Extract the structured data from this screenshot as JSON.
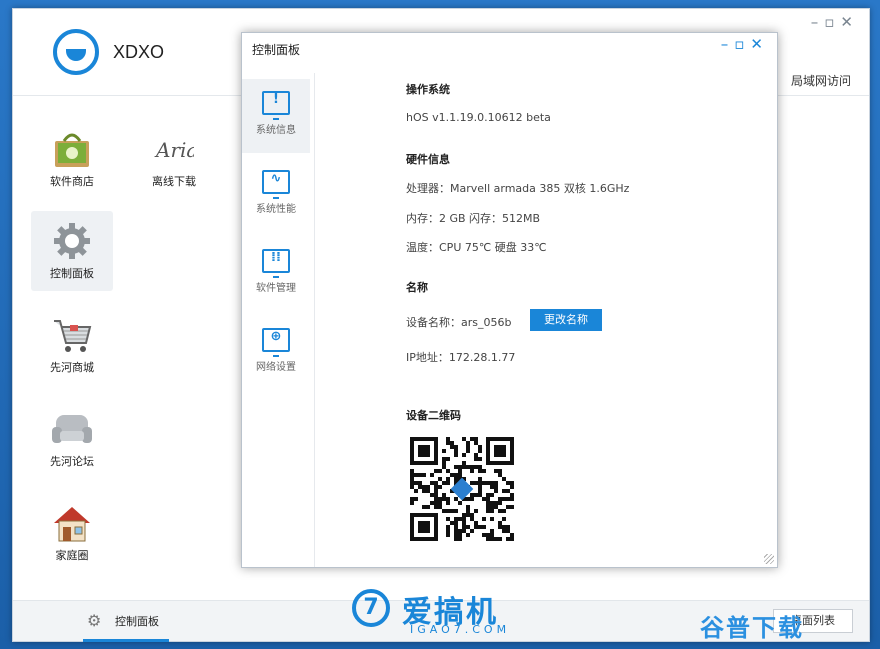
{
  "app": {
    "title": "XDXO",
    "lan_access": "局域网访问"
  },
  "left_apps": [
    {
      "label": "软件商店"
    },
    {
      "label": "离线下载"
    },
    {
      "label": "控制面板"
    },
    {
      "label": "先河商城"
    },
    {
      "label": "先河论坛"
    },
    {
      "label": "家庭圈"
    }
  ],
  "taskbar": {
    "item_label": "控制面板",
    "right_button": "桌面列表"
  },
  "dialog": {
    "title": "控制面板",
    "sidebar": [
      {
        "label": "系统信息",
        "icon": "exclamation-monitor-icon"
      },
      {
        "label": "系统性能",
        "icon": "pulse-monitor-icon"
      },
      {
        "label": "软件管理",
        "icon": "grid-monitor-icon"
      },
      {
        "label": "网络设置",
        "icon": "globe-monitor-icon"
      }
    ],
    "os": {
      "title": "操作系统",
      "version": "hOS v1.1.19.0.10612 beta"
    },
    "hardware": {
      "title": "硬件信息",
      "cpu": "处理器：Marvell armada 385 双核 1.6GHz",
      "memory": "内存：2 GB 闪存：512MB",
      "temp": "温度：CPU 75℃ 硬盘 33℃"
    },
    "name": {
      "title": "名称",
      "device_name": "设备名称：ars_056b",
      "rename_button": "更改名称",
      "ip": "IP地址：172.28.1.77"
    },
    "qr": {
      "title": "设备二维码"
    }
  },
  "watermark": {
    "text": "爱搞机",
    "sub": "IGAO7.COM",
    "glyph": "7",
    "corner": "谷普下载"
  },
  "colors": {
    "accent": "#1a86d8",
    "desktop": "#1e63ad"
  }
}
